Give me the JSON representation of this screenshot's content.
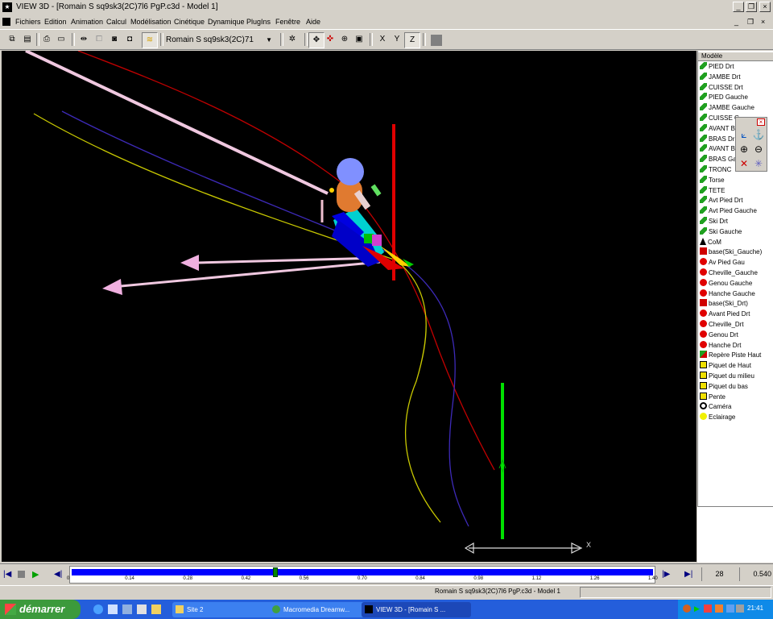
{
  "window": {
    "title": "VIEW 3D - [Romain S sq9sk3(2C)7l6 PgP.c3d - Model 1]"
  },
  "menu": [
    "Fichiers",
    "Edition",
    "Animation",
    "Calcul",
    "Modélisation",
    "Cinétique",
    "Dynamique",
    "PlugIns",
    "Fenêtre",
    "Aide"
  ],
  "toolbar": {
    "model_select": "Romain S sq9sk3(2C)71",
    "axis_x": "X",
    "axis_y": "Y",
    "axis_z": "Z"
  },
  "model_panel": {
    "header": "Modèle",
    "items": [
      {
        "label": "PIED Drt",
        "icon": "segment-icon"
      },
      {
        "label": "JAMBE Drt",
        "icon": "segment-icon"
      },
      {
        "label": "CUISSE Drt",
        "icon": "segment-icon"
      },
      {
        "label": "PIED Gauche",
        "icon": "segment-icon"
      },
      {
        "label": "JAMBE Gauche",
        "icon": "segment-icon"
      },
      {
        "label": "CUISSE G",
        "icon": "segment-icon"
      },
      {
        "label": "AVANT B",
        "icon": "segment-icon"
      },
      {
        "label": "BRAS Dr",
        "icon": "segment-icon"
      },
      {
        "label": "AVANT B",
        "icon": "segment-icon"
      },
      {
        "label": "BRAS Ga",
        "icon": "segment-icon"
      },
      {
        "label": "TRONC",
        "icon": "segment-icon"
      },
      {
        "label": "Torse",
        "icon": "segment-icon"
      },
      {
        "label": "TETE",
        "icon": "segment-icon"
      },
      {
        "label": "Avt Pied Drt",
        "icon": "segment-icon"
      },
      {
        "label": "Avt Pied Gauche",
        "icon": "segment-icon"
      },
      {
        "label": "Ski Drt",
        "icon": "segment-icon"
      },
      {
        "label": "Ski Gauche",
        "icon": "segment-icon"
      },
      {
        "label": "CoM",
        "icon": "com-icon"
      },
      {
        "label": "base(Ski_Gauche)",
        "icon": "base-icon"
      },
      {
        "label": "Av Pied Gau",
        "icon": "marker-icon"
      },
      {
        "label": "Cheville_Gauche",
        "icon": "marker-icon"
      },
      {
        "label": "Genou Gauche",
        "icon": "marker-icon"
      },
      {
        "label": "Hanche Gauche",
        "icon": "marker-icon"
      },
      {
        "label": "base(Ski_Drt)",
        "icon": "base-icon"
      },
      {
        "label": "Avant Pied Drt",
        "icon": "marker-icon"
      },
      {
        "label": "Cheville_Drt",
        "icon": "marker-icon"
      },
      {
        "label": "Genou Drt",
        "icon": "marker-icon"
      },
      {
        "label": "Hanche Drt",
        "icon": "marker-icon"
      },
      {
        "label": "Repère Piste Haut",
        "icon": "frame-icon"
      },
      {
        "label": "Piquet de Haut",
        "icon": "gate-icon"
      },
      {
        "label": "Piquet du milieu",
        "icon": "gate-icon"
      },
      {
        "label": "Piquet du bas",
        "icon": "gate-icon"
      },
      {
        "label": "Pente",
        "icon": "gate-icon"
      },
      {
        "label": "Caméra",
        "icon": "camera-icon"
      },
      {
        "label": "Eclairage",
        "icon": "light-icon"
      }
    ]
  },
  "viewport": {
    "axis_label": "X",
    "up_label": "Y"
  },
  "playback": {
    "frame": "28",
    "time": "0.540",
    "ticks": [
      "0",
      "0.14",
      "0.28",
      "0.42",
      "0.56",
      "0.70",
      "0.84",
      "0.98",
      "1.12",
      "1.26",
      "1.40"
    ],
    "progress": 0.35
  },
  "statusbar": {
    "text": "Romain S sq9sk3(2C)7l6 PgP.c3d - Model 1"
  },
  "taskbar": {
    "start": "démarrer",
    "tasks": [
      "Site 2",
      "Macromedia Dreamw...",
      "VIEW 3D - [Romain S ..."
    ],
    "clock": "21:41"
  },
  "colors": {
    "viewport_bg": "#000000",
    "timeline": "#0000ff",
    "taskbar": "#245edb",
    "start": "#3c9a3c"
  }
}
